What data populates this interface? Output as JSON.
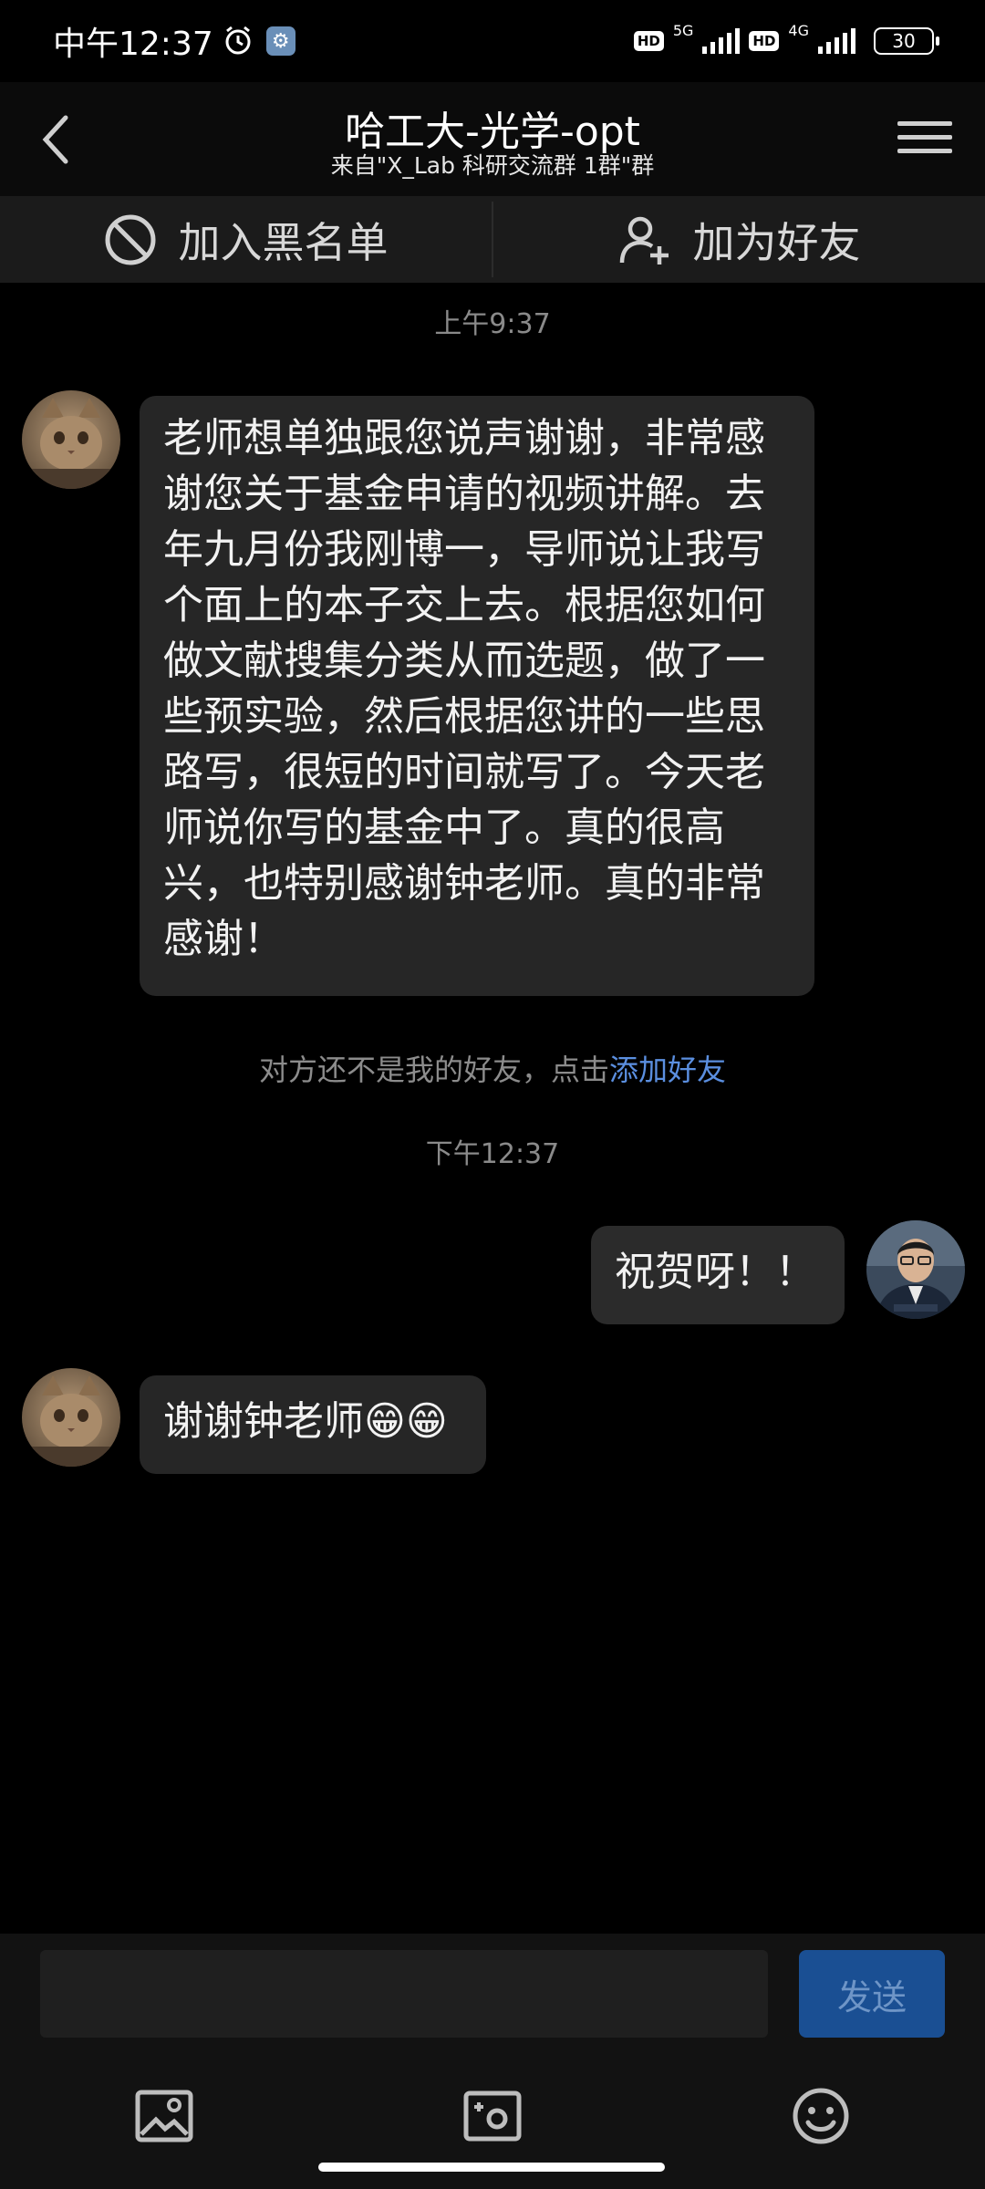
{
  "status_bar": {
    "time": "中午12:37",
    "network_1": "5G",
    "network_2": "4G",
    "hd_1": "HD",
    "hd_2": "HD",
    "battery": "30"
  },
  "header": {
    "title": "哈工大-光学-opt",
    "subtitle": "来自\"X_Lab 科研交流群 1群\"群"
  },
  "actions": {
    "blacklist_label": "加入黑名单",
    "add_friend_label": "加为好友"
  },
  "chat": {
    "timestamp_1": "上午9:37",
    "message_1": "老师想单独跟您说声谢谢，非常感谢您关于基金申请的视频讲解。去年九月份我刚博一，导师说让我写个面上的本子交上去。根据您如何做文献搜集分类从而选题，做了一些预实验，然后根据您讲的一些思路写，很短的时间就写了。今天老师说你写的基金中了。真的很高兴，也特别感谢钟老师。真的非常感谢！",
    "notice_text": "对方还不是我的好友，点击",
    "notice_link": "添加好友",
    "timestamp_2": "下午12:37",
    "message_2": "祝贺呀！！",
    "message_3": "谢谢钟老师😁😁"
  },
  "input": {
    "send_label": "发送"
  },
  "icons": {
    "toolbar": [
      "image-icon",
      "camera-icon",
      "emoji-icon"
    ]
  },
  "colors": {
    "background": "#000000",
    "bubble": "#262626",
    "link": "#5b8fe0",
    "send_button": "#1a4f93"
  }
}
